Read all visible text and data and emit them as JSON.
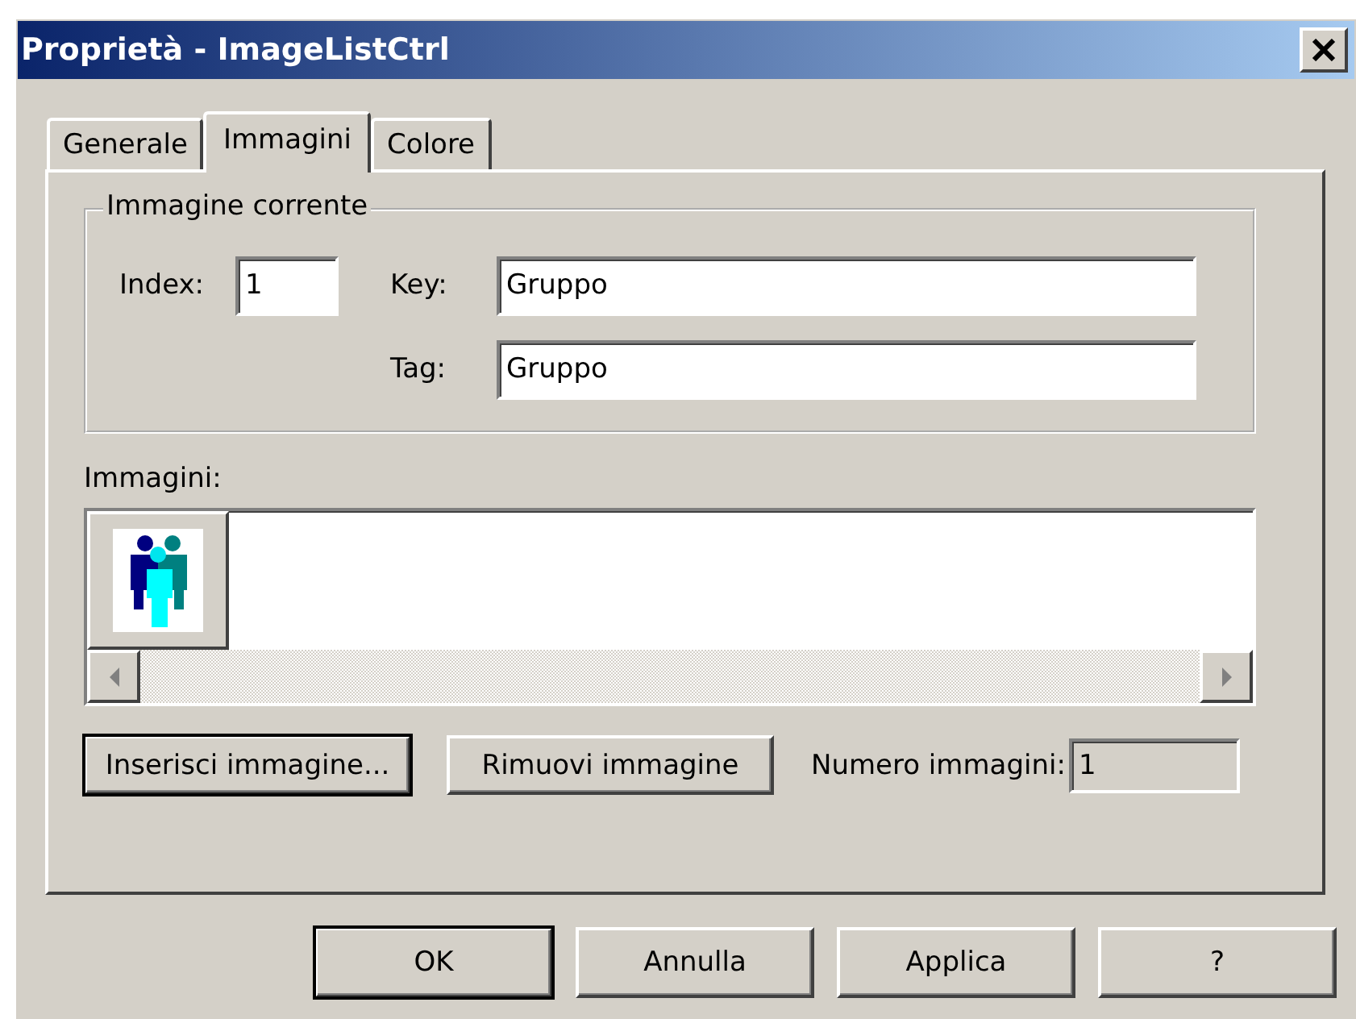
{
  "window": {
    "title": "Proprietà - ImageListCtrl"
  },
  "tabs": [
    {
      "label": "Generale",
      "selected": false
    },
    {
      "label": "Immagini",
      "selected": true
    },
    {
      "label": "Colore",
      "selected": false
    }
  ],
  "current_image": {
    "title": "Immagine corrente",
    "fields": [
      {
        "label": "Index:",
        "value": "1"
      },
      {
        "label": "Key:",
        "value": "Gruppo"
      },
      {
        "label": "Tag:",
        "value": "Gruppo"
      }
    ]
  },
  "images": {
    "label": "Immagini:"
  },
  "image_buttons": [
    {
      "label": "Inserisci immagine...",
      "default": true
    },
    {
      "label": "Rimuovi immagine",
      "default": false
    }
  ],
  "image_count": {
    "label": "Numero immagini:",
    "value": "1",
    "disabled": true
  },
  "dialog_buttons": [
    {
      "label": "OK",
      "default": true
    },
    {
      "label": "Annulla",
      "default": false
    },
    {
      "label": "Applica",
      "default": false
    },
    {
      "label": "?",
      "default": false
    }
  ]
}
